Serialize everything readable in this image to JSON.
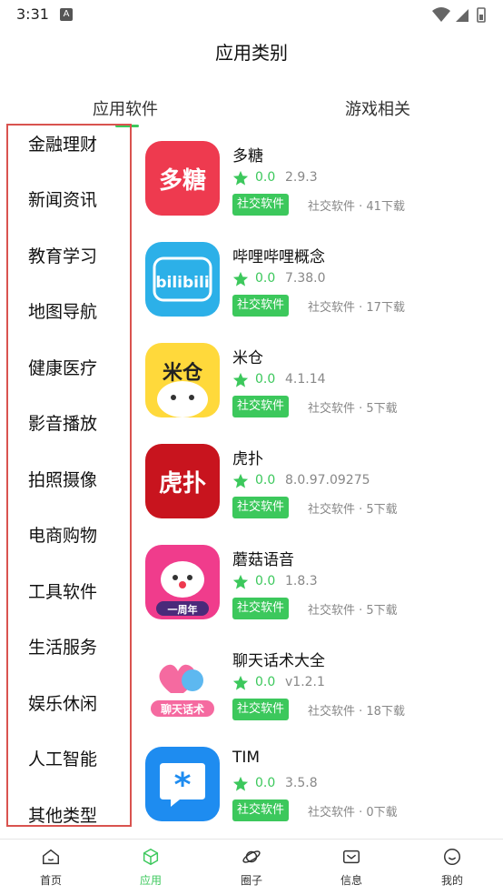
{
  "status_bar": {
    "time": "3:31",
    "notification_icon": "A"
  },
  "header": {
    "title": "应用类别"
  },
  "tabs": [
    {
      "label": "应用软件",
      "active": true
    },
    {
      "label": "游戏相关",
      "active": false
    }
  ],
  "categories": [
    "金融理财",
    "新闻资讯",
    "教育学习",
    "地图导航",
    "健康医疗",
    "影音播放",
    "拍照摄像",
    "电商购物",
    "工具软件",
    "生活服务",
    "娱乐休闲",
    "人工智能",
    "其他类型"
  ],
  "apps": [
    {
      "name": "多糖",
      "rating": "0.0",
      "version": "2.9.3",
      "tag": "社交软件",
      "meta": "社交软件 · 41下载",
      "icon_text": "多糖",
      "icon_bg": "#ee3a4f"
    },
    {
      "name": "哔哩哔哩概念",
      "rating": "0.0",
      "version": "7.38.0",
      "tag": "社交软件",
      "meta": "社交软件 · 17下载",
      "icon_text": "bilibili",
      "icon_bg": "#2cb0e8"
    },
    {
      "name": "米仓",
      "rating": "0.0",
      "version": "4.1.14",
      "tag": "社交软件",
      "meta": "社交软件 · 5下载",
      "icon_text": "米仓",
      "icon_bg": "#ffd93b"
    },
    {
      "name": "虎扑",
      "rating": "0.0",
      "version": "8.0.97.09275",
      "tag": "社交软件",
      "meta": "社交软件 · 5下载",
      "icon_text": "虎扑",
      "icon_bg": "#c8141e"
    },
    {
      "name": "蘑菇语音",
      "rating": "0.0",
      "version": "1.8.3",
      "tag": "社交软件",
      "meta": "社交软件 · 5下载",
      "icon_text": "一周年",
      "icon_bg": "#f03c8c"
    },
    {
      "name": "聊天话术大全",
      "rating": "0.0",
      "version": "v1.2.1",
      "tag": "社交软件",
      "meta": "社交软件 · 18下载",
      "icon_text": "聊天话术",
      "icon_bg": "#ffffff"
    },
    {
      "name": "TIM",
      "rating": "0.0",
      "version": "3.5.8",
      "tag": "社交软件",
      "meta": "社交软件 · 0下载",
      "icon_text": "*",
      "icon_bg": "#1e8cf0"
    }
  ],
  "bottom_nav": [
    {
      "label": "首页",
      "icon": "home-icon",
      "active": false
    },
    {
      "label": "应用",
      "icon": "cube-icon",
      "active": true
    },
    {
      "label": "圈子",
      "icon": "planet-icon",
      "active": false
    },
    {
      "label": "信息",
      "icon": "mail-icon",
      "active": false
    },
    {
      "label": "我的",
      "icon": "profile-icon",
      "active": false
    }
  ],
  "colors": {
    "accent": "#3cc85c",
    "highlight_border": "#d9534f"
  }
}
